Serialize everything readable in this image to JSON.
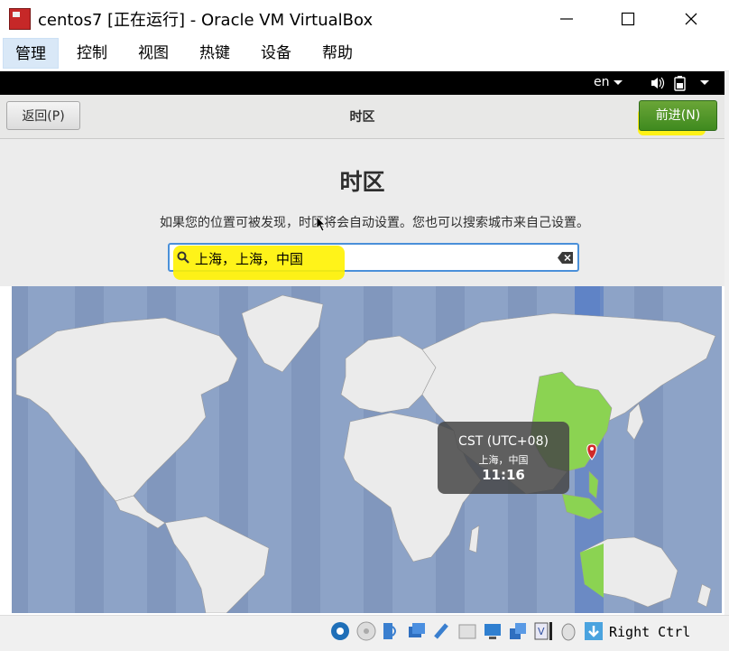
{
  "window": {
    "title": "centos7 [正在运行] - Oracle VM VirtualBox"
  },
  "menubar": {
    "items": [
      "管理",
      "控制",
      "视图",
      "热键",
      "设备",
      "帮助"
    ]
  },
  "topbar": {
    "language": "en"
  },
  "header": {
    "back_label": "返回(P)",
    "title": "时区",
    "next_label": "前进(N)"
  },
  "content": {
    "title": "时区",
    "subtitle": "如果您的位置可被发现，时区将会自动设置。您也可以搜索城市来自己设置。",
    "search_value": "上海，上海，中国"
  },
  "tooltip": {
    "timezone": "CST (UTC+08)",
    "location": "上海，中国",
    "time": "11:16"
  },
  "statusbar": {
    "host_key": "Right Ctrl",
    "icons": [
      "optical-drive-icon",
      "cd-icon",
      "audio-icon",
      "network-icon",
      "usb-icon",
      "shared-folder-icon",
      "display-icon",
      "network-adapter-icon",
      "video-capture-icon",
      "mouse-integration-icon",
      "keyboard-capture-icon"
    ]
  },
  "colors": {
    "accent_green": "#4e9a2a",
    "highlight": "#fff200",
    "map_ocean": "#8da3c7",
    "map_land": "#ebebeb",
    "selected_tz": "#8bd352",
    "search_border": "#4a90d9"
  }
}
